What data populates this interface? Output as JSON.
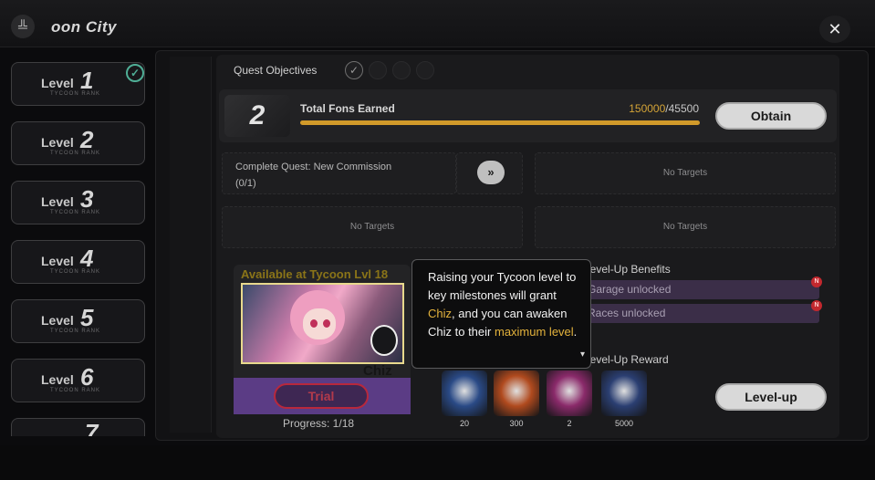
{
  "window": {
    "title": "oon  City",
    "logo_glyph": "╩",
    "close_glyph": "✕"
  },
  "sidebar": {
    "level_word": "Level",
    "sub_label": "TYCOON RANK",
    "items": [
      {
        "num": "1",
        "completed": true
      },
      {
        "num": "2",
        "completed": false
      },
      {
        "num": "3",
        "completed": false
      },
      {
        "num": "4",
        "completed": false
      },
      {
        "num": "5",
        "completed": false
      },
      {
        "num": "6",
        "completed": false
      },
      {
        "num": "7",
        "completed": false
      }
    ],
    "check_icon": "check-circle-icon",
    "check_glyph": "✓"
  },
  "quest": {
    "objectives_label": "Quest Objectives",
    "stage_number": "2",
    "fons_label": "Total Fons Earned",
    "fons_current": "150000",
    "fons_sep": "/",
    "fons_target": "45500",
    "progress_fraction": 1.0,
    "obtain_label": "Obtain",
    "commission_text": "Complete Quest: New Commission",
    "commission_count": "(0/1)",
    "go_glyph": "»",
    "no_targets": [
      "No Targets",
      "No Targets",
      "No Targets"
    ]
  },
  "character_card": {
    "availability": "Available at Tycoon Lvl 18",
    "name": "Chiz",
    "trial_label": "Trial",
    "progress": "Progress: 1/18"
  },
  "benefits": {
    "title": "Level-Up Benefits",
    "rows": [
      "Garage unlocked",
      "Races unlocked"
    ],
    "new_badge": "N"
  },
  "rewards": {
    "title": "Level-Up Reward",
    "items": [
      {
        "icon": "blue-orb-icon",
        "amount": "20",
        "color": "#2a4a86"
      },
      {
        "icon": "fuel-ticket-icon",
        "amount": "300",
        "color": "#b04a1e"
      },
      {
        "icon": "card-pack-icon",
        "amount": "2",
        "color": "#8a2a6a"
      },
      {
        "icon": "gold-coin-icon",
        "amount": "5000",
        "color": "#2b3f72"
      }
    ],
    "levelup_label": "Level-up"
  },
  "tooltip": {
    "part1": "Raising your Tycoon level to key milestones will grant ",
    "hl1": "Chiz",
    "part2": ", and you can awaken Chiz to their ",
    "hl2": "maximum level",
    "part3": ".",
    "more_glyph": "▾"
  },
  "colors": {
    "accent_gold": "#d19a2a",
    "completed_teal": "#4fae96",
    "card_purple": "#5b3c85",
    "trial_red": "#b8283c"
  }
}
